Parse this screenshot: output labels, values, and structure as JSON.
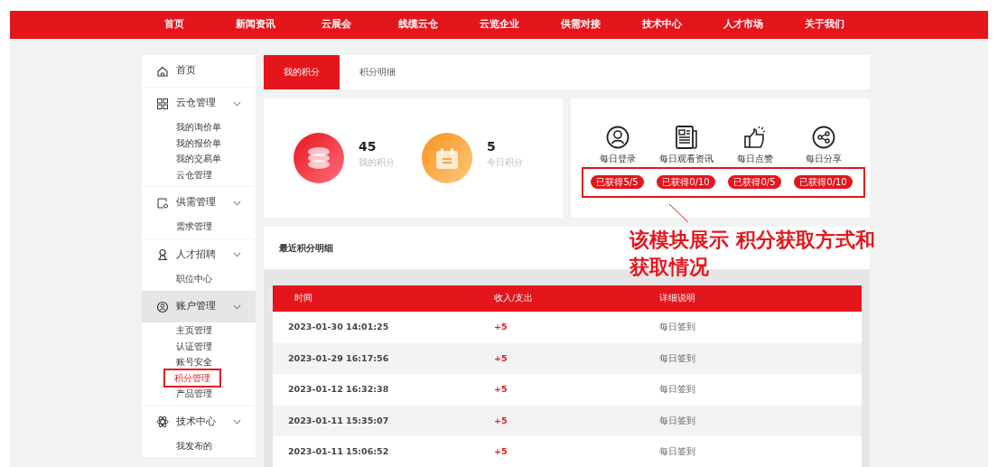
{
  "nav": [
    {
      "label": "首页"
    },
    {
      "label": "新闻资讯"
    },
    {
      "label": "云展会"
    },
    {
      "label": "线缆云仓"
    },
    {
      "label": "云览企业"
    },
    {
      "label": "供需对接"
    },
    {
      "label": "技术中心"
    },
    {
      "label": "人才市场"
    },
    {
      "label": "关于我们"
    }
  ],
  "sidebar": [
    {
      "label": "首页",
      "expanded": false,
      "selected": false
    },
    {
      "label": "云仓管理",
      "expanded": true,
      "selected": false,
      "children": [
        {
          "label": "我的询价单",
          "selected": false
        },
        {
          "label": "我的报价单",
          "selected": false
        },
        {
          "label": "我的交易单",
          "selected": false
        },
        {
          "label": "云仓管理",
          "selected": false
        }
      ]
    },
    {
      "label": "供需管理",
      "expanded": true,
      "selected": false,
      "children": [
        {
          "label": "需求管理",
          "selected": false
        }
      ]
    },
    {
      "label": "人才招聘",
      "expanded": true,
      "selected": false,
      "children": [
        {
          "label": "职位中心",
          "selected": false
        }
      ]
    },
    {
      "label": "账户管理",
      "expanded": true,
      "selected": true,
      "children": [
        {
          "label": "主页管理",
          "selected": false
        },
        {
          "label": "认证管理",
          "selected": false
        },
        {
          "label": "账号安全",
          "selected": false
        },
        {
          "label": "积分管理",
          "selected": true
        },
        {
          "label": "产品管理",
          "selected": false
        }
      ]
    },
    {
      "label": "技术中心",
      "expanded": true,
      "selected": false,
      "children": [
        {
          "label": "我发布的",
          "selected": false
        }
      ]
    }
  ],
  "tabs": [
    {
      "label": "我的积分",
      "selected": true
    },
    {
      "label": "积分明细",
      "selected": false
    }
  ],
  "stats": [
    {
      "value": "45",
      "label": "我的积分"
    },
    {
      "value": "5",
      "label": "今日积分"
    }
  ],
  "tasks": [
    {
      "label": "每日登录",
      "progress": "已获得5/5"
    },
    {
      "label": "每日观看资讯",
      "progress": "已获得0/10"
    },
    {
      "label": "每日点赞",
      "progress": "已获得0/5"
    },
    {
      "label": "每日分享",
      "progress": "已获得0/10"
    }
  ],
  "recent": {
    "title": "最近积分明细",
    "columns": [
      "时间",
      "收入/支出",
      "详细说明"
    ],
    "rows": [
      [
        "2023-01-30 14:01:25",
        "+5",
        "每日签到"
      ],
      [
        "2023-01-29 16:17:56",
        "+5",
        "每日签到"
      ],
      [
        "2023-01-12 16:32:38",
        "+5",
        "每日签到"
      ],
      [
        "2023-01-11 15:35:07",
        "+5",
        "每日签到"
      ],
      [
        "2023-01-11 15:06:52",
        "+5",
        "每日签到"
      ]
    ]
  },
  "annotation": {
    "lines": [
      "该模块展示 积分获取方式和",
      "获取情况"
    ]
  }
}
